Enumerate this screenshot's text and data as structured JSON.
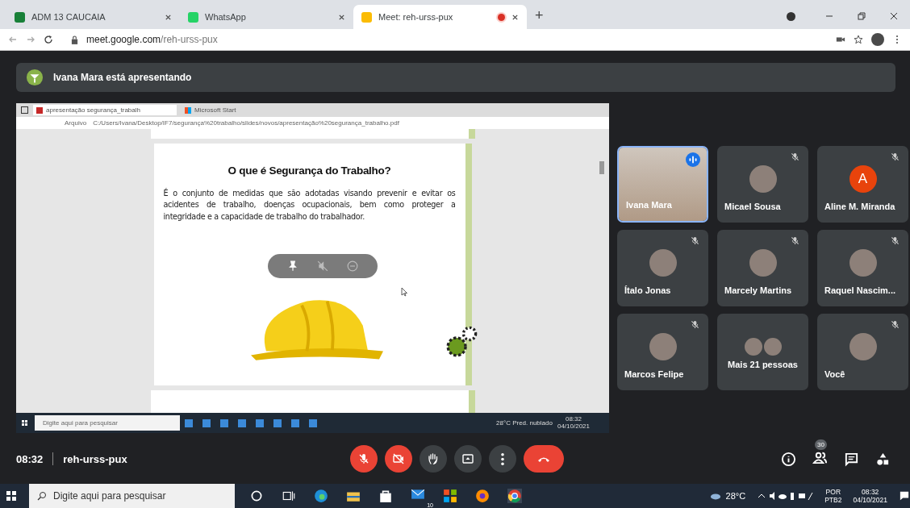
{
  "browser": {
    "tabs": [
      {
        "title": "ADM 13 CAUCAIA",
        "selected": false,
        "recording": false
      },
      {
        "title": "WhatsApp",
        "selected": false,
        "recording": false
      },
      {
        "title": "Meet: reh-urss-pux",
        "selected": true,
        "recording": true
      }
    ],
    "new_tab": "+",
    "url_host": "meet.google.com",
    "url_path": "/reh-urss-pux"
  },
  "presenter_banner": "Ivana Mara está apresentando",
  "shared_screen": {
    "tabs": [
      {
        "title": "apresentação segurança_trabalh",
        "selected": true
      },
      {
        "title": "Microsoft Start",
        "selected": false
      }
    ],
    "address_label": "Arquivo",
    "address": "C:/Users/Ivana/Desktop/IF7/segurança%20trabalho/slides/novos/apresentação%20segurança_trabalho.pdf",
    "slide_title": "O que é Segurança do Trabalho?",
    "slide_text": "É o conjunto de medidas que são adotadas visando prevenir e evitar os acidentes de trabalho, doenças ocupacionais, bem como proteger a integridade e a capacidade de trabalho do trabalhador.",
    "taskbar": {
      "search_placeholder": "Digite aqui para pesquisar",
      "weather": "28°C  Pred. nublado",
      "time": "08:32",
      "date": "04/10/2021"
    }
  },
  "participants": [
    {
      "name": "Ivana Mara",
      "kind": "video",
      "muted": false,
      "speaking": true
    },
    {
      "name": "Micael Sousa",
      "kind": "photo",
      "muted": true,
      "speaking": false
    },
    {
      "name": "Aline M. Miranda",
      "kind": "letter",
      "initial": "A",
      "muted": true,
      "speaking": false
    },
    {
      "name": "Ítalo Jonas",
      "kind": "photo",
      "muted": true,
      "speaking": false
    },
    {
      "name": "Marcely Martins",
      "kind": "photo",
      "muted": true,
      "speaking": false
    },
    {
      "name": "Raquel Nascim...",
      "kind": "photo",
      "muted": true,
      "speaking": false
    },
    {
      "name": "Marcos Felipe",
      "kind": "photo",
      "muted": true,
      "speaking": false
    },
    {
      "name": "Mais 21 pessoas",
      "kind": "group",
      "muted": false,
      "speaking": false
    },
    {
      "name": "Você",
      "kind": "photo",
      "muted": true,
      "speaking": false
    }
  ],
  "meeting_bar": {
    "time": "08:32",
    "code": "reh-urss-pux",
    "controls": [
      {
        "kind": "mic",
        "off": true
      },
      {
        "kind": "camera",
        "off": true
      },
      {
        "kind": "hand",
        "off": false
      },
      {
        "kind": "present",
        "off": false
      },
      {
        "kind": "more",
        "off": false
      },
      {
        "kind": "hangup"
      }
    ],
    "people_count": "30"
  },
  "taskbar": {
    "search_placeholder": "Digite aqui para pesquisar",
    "mail_badge": "10",
    "temperature": "28°C",
    "language": "POR",
    "layout": "PTB2",
    "time": "08:32",
    "date": "04/10/2021"
  }
}
